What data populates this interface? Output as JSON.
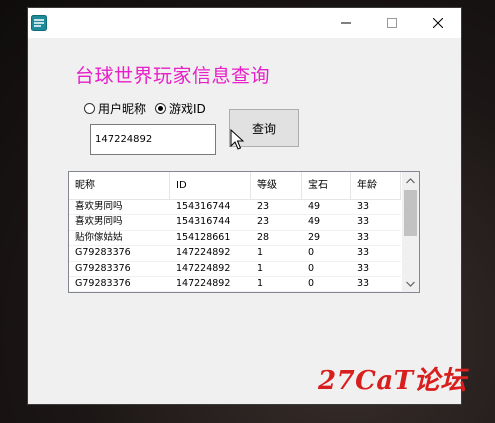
{
  "window": {
    "heading": "台球世界玩家信息查询"
  },
  "search": {
    "radio_nickname": "用户昵称",
    "radio_gameid": "游戏ID",
    "selected": "gameid",
    "id_value": "147224892",
    "query_label": "查询"
  },
  "table": {
    "headers": [
      "昵称",
      "ID",
      "等级",
      "宝石",
      "年龄"
    ],
    "rows": [
      [
        "喜欢男同吗",
        "154316744",
        "23",
        "49",
        "33"
      ],
      [
        "喜欢男同吗",
        "154316744",
        "23",
        "49",
        "33"
      ],
      [
        "贴你傢姑姑",
        "154128661",
        "28",
        "29",
        "33"
      ],
      [
        "G79283376",
        "147224892",
        "1",
        "0",
        "33"
      ],
      [
        "G79283376",
        "147224892",
        "1",
        "0",
        "33"
      ],
      [
        "G79283376",
        "147224892",
        "1",
        "0",
        "33"
      ]
    ]
  },
  "watermark": "27CaT论坛",
  "colors": {
    "heading": "#e81ec8",
    "watermark": "#d91e1e"
  }
}
